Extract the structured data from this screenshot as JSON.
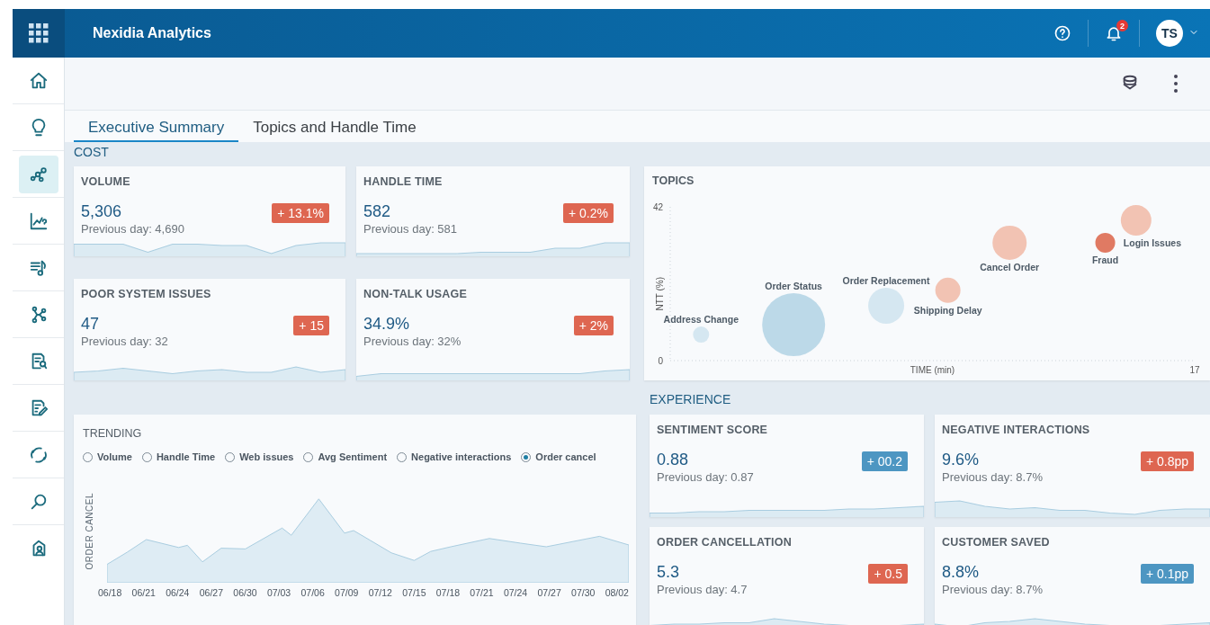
{
  "header": {
    "app_title": "Nexidia Analytics",
    "notification_count": "2",
    "avatar_initials": "TS"
  },
  "sidebar": {
    "items": [
      {
        "selected": false
      },
      {
        "selected": false
      },
      {
        "selected": true
      },
      {
        "selected": false
      },
      {
        "selected": false
      },
      {
        "selected": false
      },
      {
        "selected": false
      },
      {
        "selected": false
      },
      {
        "selected": false
      },
      {
        "selected": false
      },
      {
        "selected": false
      }
    ]
  },
  "tabs": [
    {
      "label": "Executive Summary",
      "selected": true
    },
    {
      "label": "Topics and Handle Time",
      "selected": false
    }
  ],
  "cost": {
    "title": "COST",
    "cards": [
      {
        "title": "VOLUME",
        "value": "5,306",
        "previous": "Previous day: 4,690",
        "change": "+ 13.1%",
        "color": "#de6651"
      },
      {
        "title": "HANDLE TIME",
        "value": "582",
        "previous": "Previous day: 581",
        "change": "+ 0.2%",
        "color": "#de6651"
      },
      {
        "title": "POOR SYSTEM ISSUES",
        "value": "47",
        "previous": "Previous day: 32",
        "change": "+ 15",
        "color": "#de6651"
      },
      {
        "title": "NON-TALK USAGE",
        "value": "34.9%",
        "previous": "Previous day: 32%",
        "change": "+ 2%",
        "color": "#de6651"
      }
    ]
  },
  "topics": {
    "title": "TOPICS",
    "y_top_label": "42",
    "origin_label": "0",
    "x_end_label": "17",
    "xlabel": "TIME (min)",
    "ylabel": "NTT (%)",
    "bubbles": [
      {
        "label": "Address Change",
        "color": "#d5e7f1"
      },
      {
        "label": "Order Status",
        "color": "#bcd9e8"
      },
      {
        "label": "Order Replacement",
        "color": "#d5e7f1"
      },
      {
        "label": "Shipping Delay",
        "color": "#f2c3b3"
      },
      {
        "label": "Cancel Order",
        "color": "#f2c3b3"
      },
      {
        "label": "Fraud",
        "color": "#e07a63"
      },
      {
        "label": "Login Issues",
        "color": "#f2c3b3"
      }
    ]
  },
  "trending": {
    "title": "TRENDING",
    "options": [
      {
        "label": "Volume",
        "selected": false
      },
      {
        "label": "Handle Time",
        "selected": false
      },
      {
        "label": "Web issues",
        "selected": false
      },
      {
        "label": "Avg Sentiment",
        "selected": false
      },
      {
        "label": "Negative interactions",
        "selected": false
      },
      {
        "label": "Order cancel",
        "selected": true
      }
    ],
    "ylabel": "ORDER CANCEL",
    "x_labels": [
      "06/18",
      "06/21",
      "06/24",
      "06/27",
      "06/30",
      "07/03",
      "07/06",
      "07/09",
      "07/12",
      "07/15",
      "07/18",
      "07/21",
      "07/24",
      "07/27",
      "07/30",
      "08/02"
    ]
  },
  "experience": {
    "title": "EXPERIENCE",
    "cards": [
      {
        "title": "SENTIMENT SCORE",
        "value": "0.88",
        "previous": "Previous day: 0.87",
        "change": "+ 00.2",
        "color": "#4d96c2"
      },
      {
        "title": "NEGATIVE INTERACTIONS",
        "value": "9.6%",
        "previous": "Previous day: 8.7%",
        "change": "+ 0.8pp",
        "color": "#de6651"
      },
      {
        "title": "ORDER CANCELLATION",
        "value": "5.3",
        "previous": "Previous day: 4.7",
        "change": "+ 0.5",
        "color": "#de6651"
      },
      {
        "title": "CUSTOMER SAVED",
        "value": "8.8%",
        "previous": "Previous day: 8.7%",
        "change": "+ 0.1pp",
        "color": "#4d96c2"
      }
    ]
  }
}
